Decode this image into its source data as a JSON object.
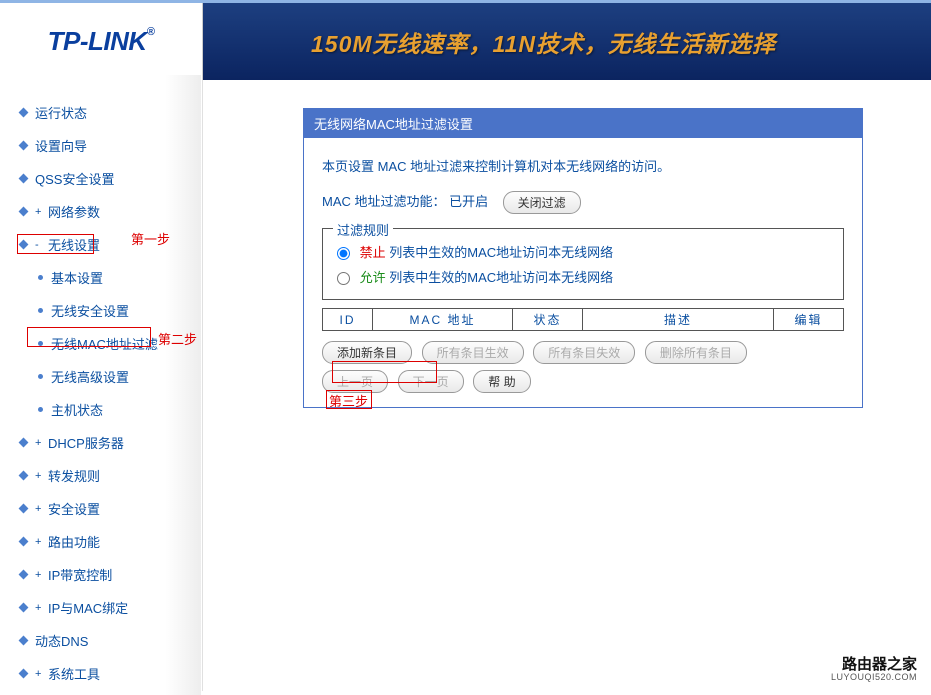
{
  "brand": {
    "logo": "TP-LINK",
    "banner": "150M无线速率，11N技术，无线生活新选择"
  },
  "sidebar": {
    "items": [
      {
        "label": "运行状态",
        "sub": false
      },
      {
        "label": "设置向导",
        "sub": false
      },
      {
        "label": "QSS安全设置",
        "sub": false
      },
      {
        "label": "网络参数",
        "sub": false,
        "expandable": true
      },
      {
        "label": "无线设置",
        "sub": false,
        "expandable": true,
        "expanded": true
      },
      {
        "label": "基本设置",
        "sub": true
      },
      {
        "label": "无线安全设置",
        "sub": true
      },
      {
        "label": "无线MAC地址过滤",
        "sub": true
      },
      {
        "label": "无线高级设置",
        "sub": true
      },
      {
        "label": "主机状态",
        "sub": true
      },
      {
        "label": "DHCP服务器",
        "sub": false,
        "expandable": true
      },
      {
        "label": "转发规则",
        "sub": false,
        "expandable": true
      },
      {
        "label": "安全设置",
        "sub": false,
        "expandable": true
      },
      {
        "label": "路由功能",
        "sub": false,
        "expandable": true
      },
      {
        "label": "IP带宽控制",
        "sub": false,
        "expandable": true
      },
      {
        "label": "IP与MAC绑定",
        "sub": false,
        "expandable": true
      },
      {
        "label": "动态DNS",
        "sub": false
      },
      {
        "label": "系统工具",
        "sub": false,
        "expandable": true
      }
    ]
  },
  "panel": {
    "title": "无线网络MAC地址过滤设置",
    "desc": "本页设置 MAC 地址过滤来控制计算机对本无线网络的访问。",
    "status_label": "MAC 地址过滤功能：",
    "status_value": "已开启",
    "toggle_btn": "关闭过滤",
    "rule_title": "过滤规则",
    "deny_word": "禁止",
    "allow_word": "允许",
    "rule_suffix": " 列表中生效的MAC地址访问本无线网络",
    "cols": [
      "ID",
      "MAC 地址",
      "状态",
      "描述",
      "编辑"
    ],
    "btns": {
      "add": "添加新条目",
      "enable_all": "所有条目生效",
      "disable_all": "所有条目失效",
      "delete_all": "删除所有条目",
      "prev": "上一页",
      "next": "下一页",
      "help": "帮 助"
    }
  },
  "annotations": {
    "step1": "第一步",
    "step2": "第二步",
    "step3": "第三步"
  },
  "watermark": {
    "cn": "路由器之家",
    "en": "LUYOUQI520.COM"
  }
}
